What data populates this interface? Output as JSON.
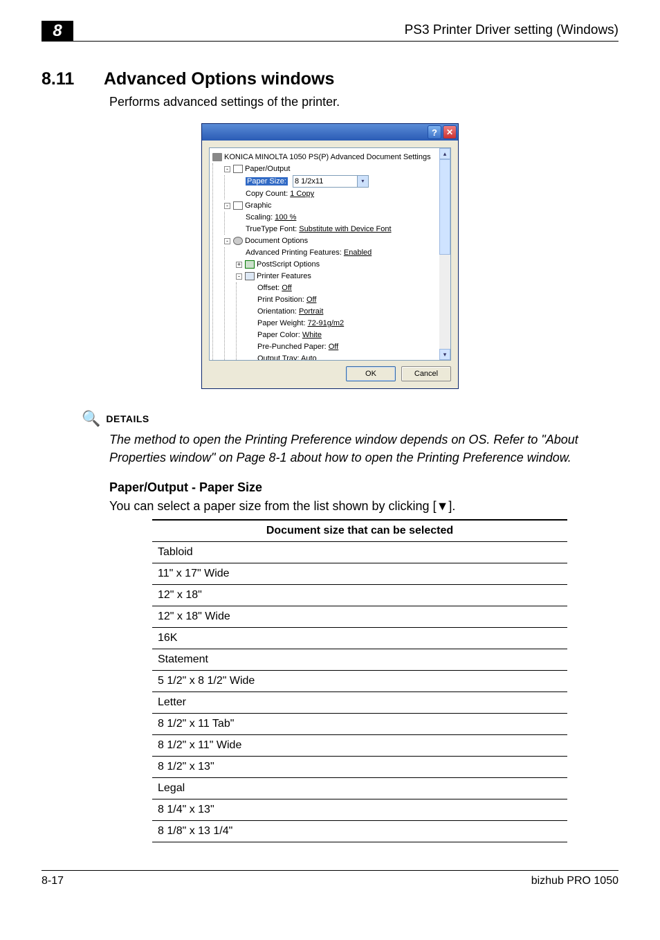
{
  "chapter_number": "8",
  "header_right": "PS3 Printer Driver setting (Windows)",
  "section": {
    "number": "8.11",
    "title": "Advanced Options windows"
  },
  "intro": "Performs advanced settings of the printer.",
  "dialog": {
    "root_label": "KONICA MINOLTA 1050 PS(P) Advanced Document Settings",
    "paper_output": {
      "label": "Paper/Output",
      "paper_size": {
        "label": "Paper Size:",
        "value": "8 1/2x11"
      },
      "copy_count": {
        "label": "Copy Count:",
        "value": "1 Copy"
      }
    },
    "graphic": {
      "label": "Graphic",
      "scaling": {
        "label": "Scaling:",
        "value": "100 %"
      },
      "truetype": {
        "label": "TrueType Font:",
        "value": "Substitute with Device Font"
      }
    },
    "doc_options": {
      "label": "Document Options",
      "adv_print": {
        "label": "Advanced Printing Features:",
        "value": "Enabled"
      },
      "postscript": {
        "label": "PostScript Options"
      },
      "printer_features": {
        "label": "Printer Features",
        "items": [
          {
            "label": "Offset:",
            "value": "Off"
          },
          {
            "label": "Print Position:",
            "value": "Off"
          },
          {
            "label": "Orientation:",
            "value": "Portrait"
          },
          {
            "label": "Paper Weight:",
            "value": "72-91g/m2"
          },
          {
            "label": "Paper Color:",
            "value": "White"
          },
          {
            "label": "Pre-Punched Paper:",
            "value": "Off"
          },
          {
            "label": "Output Tray:",
            "value": "Auto"
          }
        ]
      }
    },
    "ok": "OK",
    "cancel": "Cancel"
  },
  "details": {
    "heading": "DETAILS",
    "text": "The method to open the Printing Preference window depends on OS. Refer to \"About Properties window\" on Page 8-1 about how to open the Printing Preference window."
  },
  "paper_size_section": {
    "heading": "Paper/Output - Paper Size",
    "lead": "You can select a paper size from the list shown by clicking [▼].",
    "table_header": "Document size that can be selected",
    "rows": [
      "Tabloid",
      "11\" x 17\" Wide",
      "12\" x 18\"",
      "12\" x 18\" Wide",
      "16K",
      "Statement",
      "5 1/2\" x 8 1/2\" Wide",
      "Letter",
      "8 1/2\" x 11 Tab\"",
      "8 1/2\" x 11\" Wide",
      "8 1/2\" x 13\"",
      "Legal",
      "8 1/4\" x 13\"",
      "8 1/8\" x 13 1/4\""
    ]
  },
  "footer": {
    "left": "8-17",
    "right": "bizhub PRO 1050"
  }
}
